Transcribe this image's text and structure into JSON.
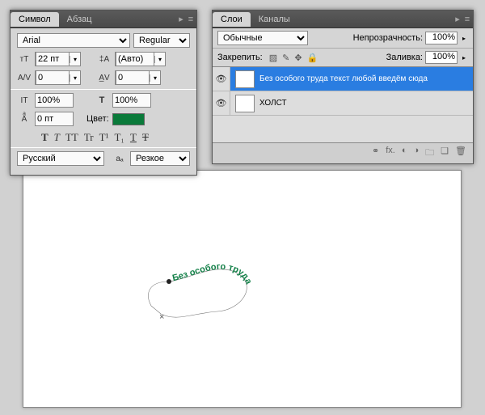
{
  "character_panel": {
    "tab_active": "Символ",
    "tab_inactive": "Абзац",
    "font_family": "Arial",
    "font_style": "Regular",
    "font_size": "22 пт",
    "leading": "(Авто)",
    "kerning": "0",
    "tracking": "0",
    "vscale": "100%",
    "hscale": "100%",
    "baseline": "0 пт",
    "color_label": "Цвет:",
    "color_hex": "#0a7a3a",
    "styles": [
      "T",
      "T",
      "TT",
      "Tr",
      "T¹",
      "T₁",
      "T",
      "Ŧ"
    ],
    "language": "Русский",
    "aa_label": "aₐ",
    "aa_mode": "Резкое"
  },
  "layers_panel": {
    "tab_active": "Слои",
    "tab_inactive": "Каналы",
    "blend_mode": "Обычные",
    "opacity_label": "Непрозрачность:",
    "opacity_value": "100%",
    "lock_label": "Закрепить:",
    "fill_label": "Заливка:",
    "fill_value": "100%",
    "layers": [
      {
        "name": "Без особого труда текст любой введём сюда",
        "type": "T",
        "visible": true,
        "selected": true
      },
      {
        "name": "ХОЛСТ",
        "type": "",
        "visible": true,
        "selected": false
      }
    ]
  },
  "canvas": {
    "text_on_path": "Без особого труда"
  }
}
